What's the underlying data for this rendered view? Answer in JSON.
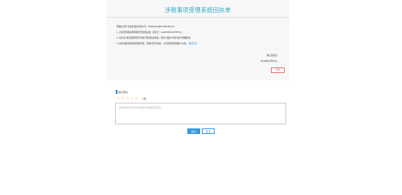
{
  "receipt": {
    "title": "涉税事项受理系统回执单",
    "lines": [
      "尊敬的 西宁市盈欣贸易有限公司（91630104MA7R9356XX）：",
      "1. 企业所得税清算申报已经办理完成，流水号：sw20200129787XX。",
      "2. 您可在\"事项受理管理\"查询已经办结的事项，同时可使用\"查询\"进行详细操作！",
      "3. 如有其他涉税事项需要办理，请按时登录系统，以免影响您的纳税人信用。"
    ],
    "link_text": "返回首页",
    "sign_office": "网上税务局",
    "sign_date": "2020年03月23日",
    "print_label": "打印"
  },
  "rating": {
    "label": "用户评价",
    "stars": [
      "☆",
      "☆",
      "☆",
      "☆",
      "☆"
    ],
    "level_text": "0星"
  },
  "feedback": {
    "placeholder": "请您在此处填写您对本次服务的满意度及建议。"
  },
  "actions": {
    "submit_label": "提交",
    "back_label": "取消"
  }
}
